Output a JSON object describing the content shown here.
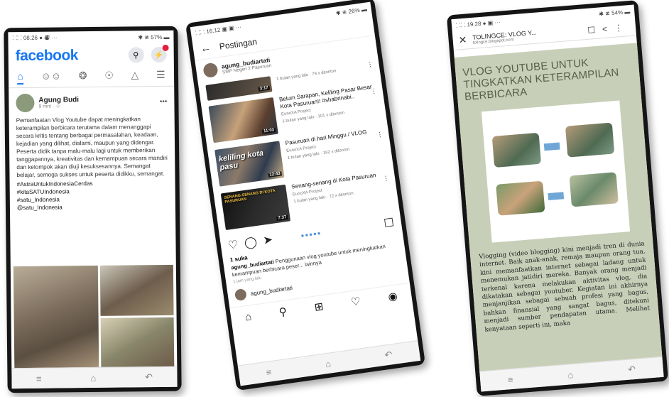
{
  "phone1": {
    "status": {
      "time": "⸬⸬ 08.26 ● ⛇ ···",
      "right": "✱ ≇ 57% ▬"
    },
    "app": {
      "logo": "facebook"
    },
    "post": {
      "author": "Agung Budi",
      "meta": "9 mnt · ☺",
      "body": "Pemanfaatan Vlog Youtube dapat meningkatkan keterampilan berbicara terutama dalam menanggapi secara kritis tentang berbagai permasalahan, keadaan, kejadian yang dilihat, dialami, maupun yang didengar. Peserta didik tanpa malu-malu lagi untuk memberikan tanggapannya, kreativitas dan kemampuan secara mandiri dan kelompok akan diuji kesuksesannya. Semangat belajar, semoga sukses untuk peserta didikku, semangat.",
      "tags": [
        "#AstraUntukIndonesiaCerdas",
        "#kitaSATUIndonesia",
        "#satu_Indonesia",
        "@satu_Indonesia"
      ]
    }
  },
  "phone2": {
    "status": {
      "time": "⸬⸬ 16.12 ▣ ▣ ···",
      "right": "✱ ≇ 26% ▬"
    },
    "header": {
      "title": "Postingan"
    },
    "user": {
      "name": "agung_budiartati",
      "location": "SMP Negeri 2 Pasuruan"
    },
    "videos": [
      {
        "thumb_text": "",
        "duration": "3:17",
        "title": "",
        "channel": "",
        "meta": "1 bulan yang lalu · 79 x ditonton"
      },
      {
        "thumb_text": "",
        "duration": "11:03",
        "title": "Belum Sarapan, Keliling Pasar Besar Kota Pasuruan!! #shabrinabi..",
        "channel": "EunoXA Project",
        "meta": "1 bulan yang lalu · 101 x ditonton"
      },
      {
        "thumb_text": "keliling kota pasu",
        "duration": "12:43",
        "title": "Pasuruan di hari Minggu / VLOG",
        "channel": "EunoXA Project",
        "meta": "1 bulan yang lalu · 162 x ditonton"
      },
      {
        "thumb_text": "SENANG-SENANG DI KOTA PASURUAN",
        "duration": "7:37",
        "title": "Senang-senang di Kota Pasuruan",
        "channel": "EunoXA Project",
        "meta": "1 bulan yang lalu · 72 x ditonton"
      }
    ],
    "likes": "1 suka",
    "caption_user": "agung_budiartati",
    "caption_text": "Penggunaan vlog youtube untuk meningkatkan kemampuan berbicara peser... lainnya",
    "time": "1 jam yang lalu",
    "comment_user": "agung_budiartati"
  },
  "phone3": {
    "status": {
      "time": "⸬⸬ 19.28 ● ▣ ···",
      "right": "✱ ≇ 54% ▬"
    },
    "browser": {
      "title": "TOLINGCE: VLOG Y...",
      "host": "tolingce.blogspot.com"
    },
    "blog": {
      "title": "VLOG YOUTUBE UNTUK TINGKATKAN KETERAMPILAN BERBICARA",
      "body": "Vlogging (video blogging) kini menjadi tren di dunia internet. Baik anak-anak, remaja maupun orang tua, kini memanfaatkan internet sebagai ladang untuk menemukan jatidiri mereka. Banyak orang menjadi terkenal karena melakukan aktivitas vlog, dia dikatakan sebagai youtuber. Kegiatan ini akhirnya menjanjikan sebagai sebuah profesi yang bagus, bahkan finansial yang sangat bagus, ditekuni menjadi sumber pendapatan utama. Melihat kenyataan seperti ini, maka"
    }
  }
}
